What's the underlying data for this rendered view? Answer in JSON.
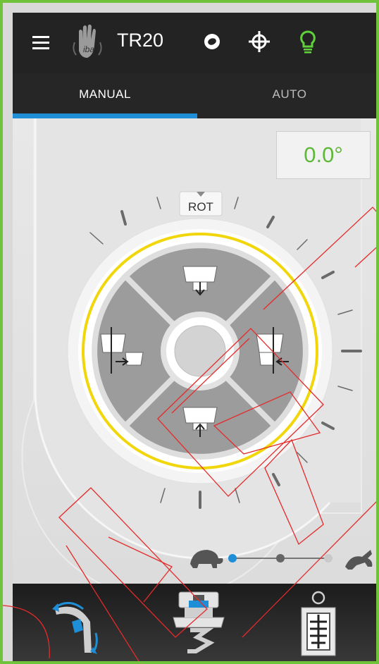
{
  "header": {
    "app_title": "TR20",
    "menu_icon": "hamburger-menu-icon",
    "logo_text": "iba",
    "icons": [
      "ring-icon",
      "crosshair-icon",
      "lightbulb-icon"
    ]
  },
  "tabs": [
    {
      "label": "MANUAL",
      "active": true
    },
    {
      "label": "AUTO",
      "active": false
    }
  ],
  "angle_display": {
    "value": "0.0°"
  },
  "dial": {
    "label": "ROT",
    "buttons": [
      "tilt-down-button",
      "tilt-left-button",
      "tilt-right-button",
      "tilt-up-button",
      "center-button"
    ]
  },
  "speed": {
    "levels": 3,
    "selected": 1,
    "slow_icon": "turtle-icon",
    "fast_icon": "rabbit-icon"
  },
  "bottom_nav": [
    "rotation-mode-icon",
    "table-mode-icon",
    "patient-position-icon"
  ],
  "colors": {
    "accent": "#1e8fd6",
    "angle": "#5fb838",
    "dial_ring": "#f2d60c",
    "bulb": "#5fd13a"
  }
}
